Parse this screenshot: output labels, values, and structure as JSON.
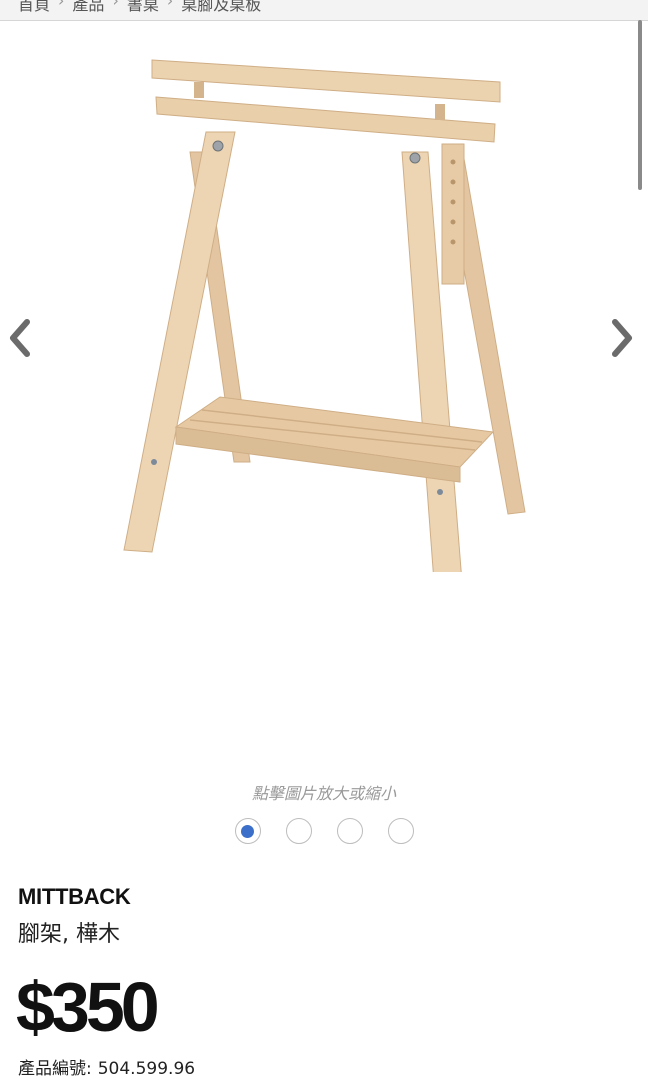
{
  "breadcrumb": [
    "首頁",
    "產品",
    "書桌",
    "桌腳及桌板"
  ],
  "gallery": {
    "zoom_hint": "點擊圖片放大或縮小",
    "image_count": 4,
    "active_index": 0,
    "image_subject": "trestle-icon"
  },
  "product": {
    "name": "MITTBACK",
    "description": "腳架, 樺木",
    "price": "$350",
    "article_label": "產品編號:",
    "article_number": "504.599.96"
  },
  "colors": {
    "accent_dot": "#3b6fc9",
    "wood": "#e8cfae"
  }
}
